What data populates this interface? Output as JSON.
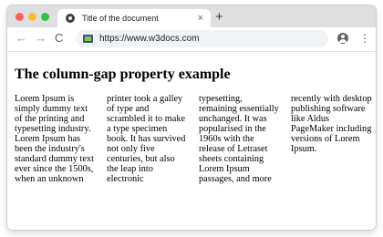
{
  "browser": {
    "tab_title": "Title of the document",
    "tab_close": "×",
    "new_tab": "+",
    "url": "https://www.w3docs.com",
    "nav_back": "←",
    "nav_forward": "→",
    "nav_reload": "C",
    "menu": "⋮"
  },
  "page": {
    "heading": "The column-gap property example",
    "body_text": "Lorem Ipsum is simply dummy text of the printing and typesetting industry. Lorem Ipsum has been the industry's standard dummy text ever since the 1500s, when an unknown printer took a galley of type and scrambled it to make a type specimen book. It has survived not only five centuries, but also the leap into electronic typesetting, remaining essentially unchanged. It was popularised in the 1960s with the release of Letraset sheets containing Lorem Ipsum passages, and more recently with desktop publishing software like Aldus PageMaker including versions of Lorem Ipsum."
  },
  "colors": {
    "close": "#fd5f57",
    "minimize": "#fdbc2e",
    "maximize": "#27c840"
  }
}
